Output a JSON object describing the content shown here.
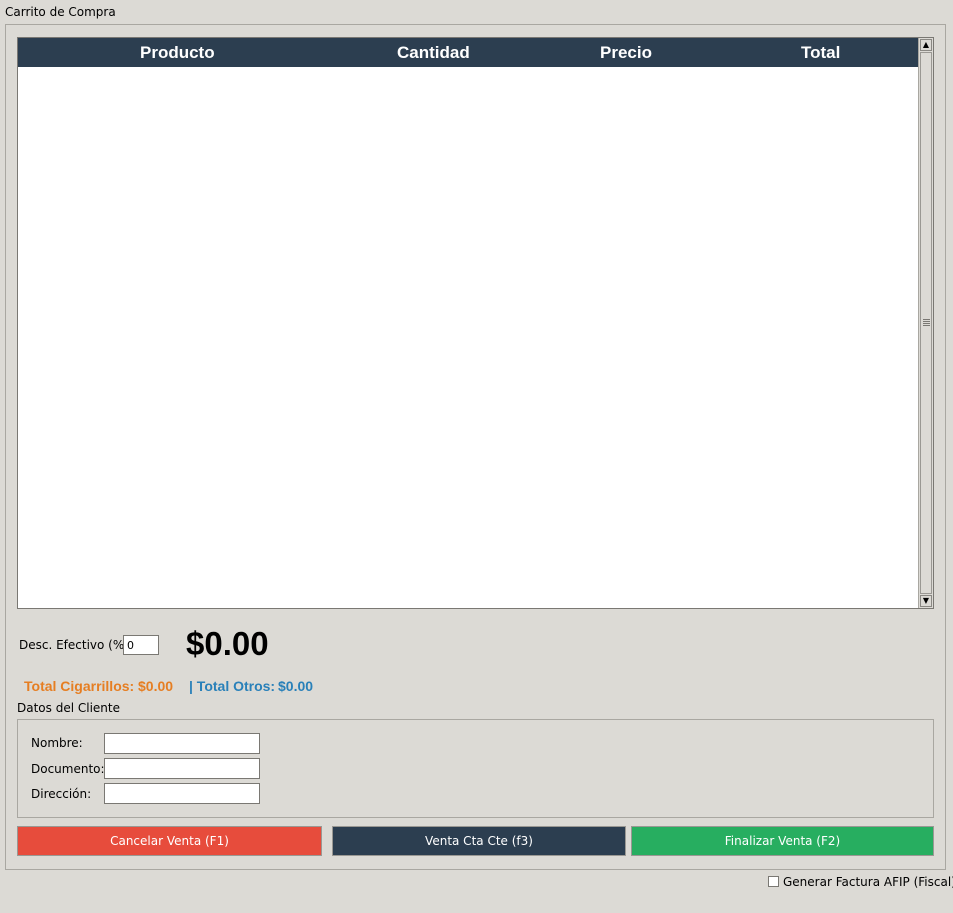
{
  "cart": {
    "title": "Carrito de Compra",
    "columns": [
      "Producto",
      "Cantidad",
      "Precio",
      "Total"
    ],
    "rows": []
  },
  "discount": {
    "label": "Desc. Efectivo (%):",
    "value": "0"
  },
  "grand_total": "$0.00",
  "summary": {
    "cigarrillos_label": "Total Cigarrillos:",
    "cigarrillos_value": "$0.00",
    "otros_label": "| Total Otros:",
    "otros_value": "$0.00",
    "cigarrillos_color": "#e67e22",
    "otros_color": "#2980b9"
  },
  "client": {
    "title": "Datos del Cliente",
    "fields": [
      {
        "label": "Nombre:",
        "value": ""
      },
      {
        "label": "Documento:",
        "value": ""
      },
      {
        "label": "Dirección:",
        "value": ""
      }
    ]
  },
  "buttons": {
    "cancel": {
      "label": "Cancelar Venta (F1)",
      "color": "#e74c3c"
    },
    "account": {
      "label": "Venta Cta Cte (f3)",
      "color": "#2c3e50"
    },
    "finish": {
      "label": "Finalizar Venta (F2)",
      "color": "#27ae60"
    }
  },
  "invoice": {
    "label": "Generar Factura AFIP (Fiscal)",
    "checked": false
  }
}
